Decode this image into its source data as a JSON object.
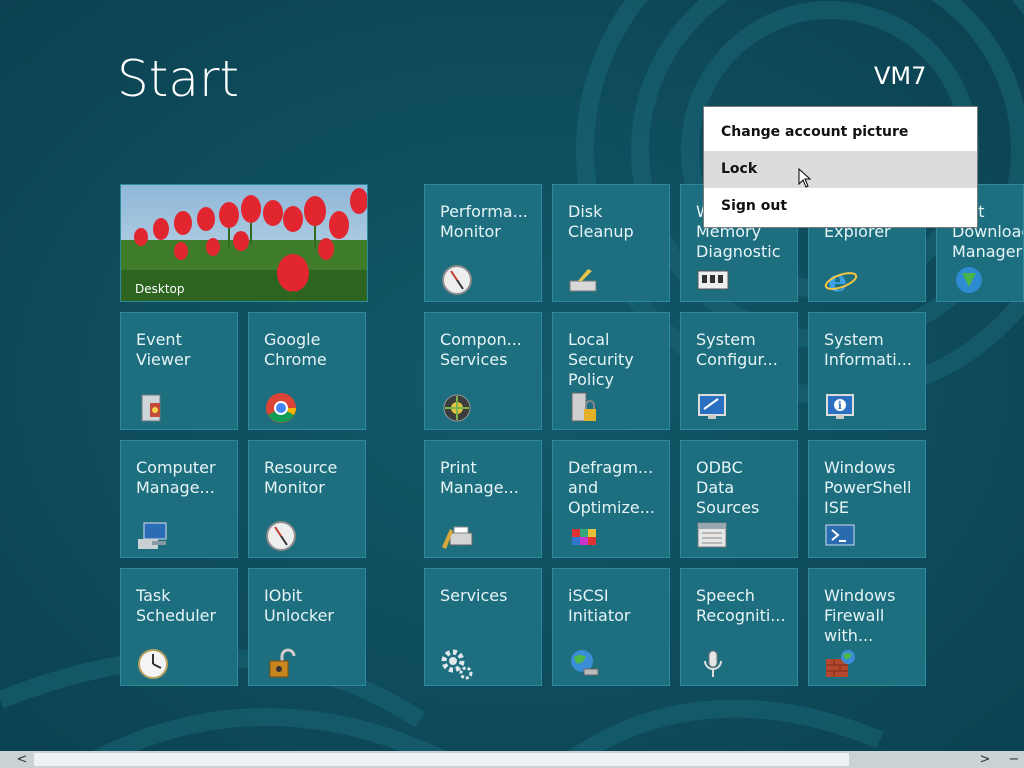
{
  "header": {
    "title": "Start",
    "user_name": "VM7"
  },
  "account_menu": {
    "items": [
      {
        "label": "Change account picture"
      },
      {
        "label": "Lock"
      },
      {
        "label": "Sign out"
      }
    ]
  },
  "tiles": {
    "desktop": {
      "label": "Desktop"
    },
    "event_viewer": {
      "label": "Event\nViewer"
    },
    "google_chrome": {
      "label": "Google\nChrome"
    },
    "computer_management": {
      "label": "Computer\nManage..."
    },
    "resource_monitor": {
      "label": "Resource\nMonitor"
    },
    "task_scheduler": {
      "label": "Task\nScheduler"
    },
    "iobit_unlocker": {
      "label": "IObit\nUnlocker"
    },
    "performance_monitor": {
      "label": "Performa...\nMonitor"
    },
    "disk_cleanup": {
      "label": "Disk\nCleanup"
    },
    "memory_diagnostic": {
      "label": "W\nMemory\nDiagnostic"
    },
    "internet_explorer": {
      "label": "\nExplorer"
    },
    "internet_download_manager": {
      "label": "rnet\nDownload\nManager"
    },
    "component_services": {
      "label": "Compon...\nServices"
    },
    "local_security_policy": {
      "label": "Local\nSecurity\nPolicy"
    },
    "system_configuration": {
      "label": "System\nConfigur..."
    },
    "system_information": {
      "label": "System\nInformati..."
    },
    "print_management": {
      "label": "Print\nManage..."
    },
    "defragment": {
      "label": "Defragm...\nand\nOptimize..."
    },
    "odbc": {
      "label": "ODBC\nData\nSources"
    },
    "powershell_ise": {
      "label": "Windows\nPowerShell\nISE"
    },
    "services": {
      "label": "Services"
    },
    "iscsi_initiator": {
      "label": "iSCSI\nInitiator"
    },
    "speech_recognition": {
      "label": "Speech\nRecogniti..."
    },
    "windows_firewall": {
      "label": "Windows\nFirewall\nwith..."
    }
  },
  "scrollbar": {
    "left_arrow": "<",
    "right_arrow": ">",
    "minus": "−"
  },
  "colors": {
    "background": "#0d4a5a",
    "tile": "#1d6e7f",
    "menu_hover": "#dcdcdc"
  }
}
